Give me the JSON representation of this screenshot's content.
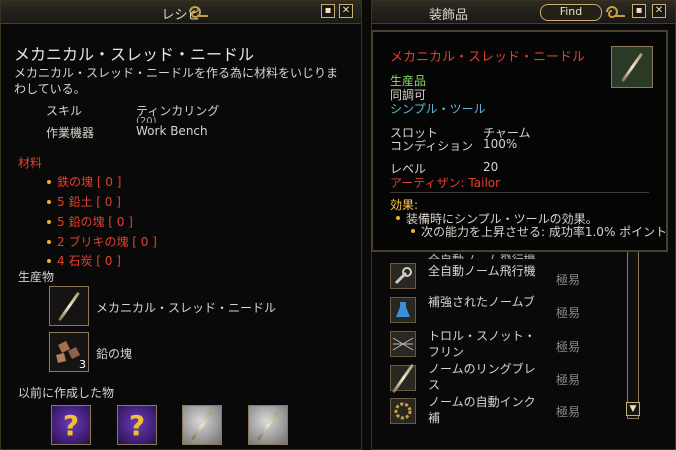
{
  "recipe": {
    "window_title": "レシピ",
    "item_name": "メカニカル・スレッド・ニードル",
    "description": "メカニカル・スレッド・ニードルを作る為に材料をいじりまわしている。",
    "skill_label": "スキル",
    "skill_value": "ティンカリング",
    "skill_value_sub": "(20)",
    "device_label": "作業機器",
    "device_value": "Work Bench",
    "materials_header": "材料",
    "materials": [
      "鉄の塊 [ 0 ]",
      "5 鉛土 [ 0 ]",
      "5 鉛の塊 [ 0 ]",
      "2 ブリキの塊 [ 0 ]",
      "4 石炭 [ 0 ]"
    ],
    "products_header": "生産物",
    "products": [
      {
        "name": "メカニカル・スレッド・ニードル",
        "icon": "needle-icon"
      },
      {
        "name": "鉛の塊",
        "icon": "lead-ore-icon",
        "count": "3"
      }
    ],
    "previous_header": "以前に作成した物",
    "previous_icons": [
      "unknown-icon",
      "unknown-icon",
      "needle-icon",
      "needle-icon"
    ]
  },
  "accessory": {
    "window_title": "装飾品",
    "find_label": "Find",
    "rows": [
      {
        "name": "全自動ノーム飛行機",
        "difficulty": "極易",
        "icon": "wrench-icon"
      },
      {
        "name": "補強されたノームブ",
        "difficulty": "極易",
        "icon": "potion-icon"
      },
      {
        "name": "トロル・スノット・フリン",
        "difficulty": "極易",
        "icon": "net-icon"
      },
      {
        "name": "ノームのリングブレス",
        "difficulty": "極易",
        "icon": "needle-icon"
      },
      {
        "name": "ノームの自動インク補",
        "difficulty": "極易",
        "icon": "gear-icon"
      }
    ]
  },
  "tooltip": {
    "item_name": "メカニカル・スレッド・ニードル",
    "tag_craft": "生産品",
    "tag_tune": "同調可",
    "tag_type": "シンプル・ツール",
    "slot_label": "スロット",
    "slot_value": "チャーム",
    "condition_label": "コンディション",
    "condition_value": "100%",
    "level_label": "レベル",
    "level_value": "20",
    "artisan_label": "アーティザン: Tailor",
    "effects_header": "効果:",
    "effect_1": "装備時にシンプル・ツールの効果。",
    "effect_2": "次の能力を上昇させる: 成功率1.0% ポイント"
  },
  "colors": {
    "accent_gold": "#f0b030",
    "red_text": "#e0402e",
    "green_text": "#88dd66",
    "cyan_text": "#5cb8e0"
  }
}
